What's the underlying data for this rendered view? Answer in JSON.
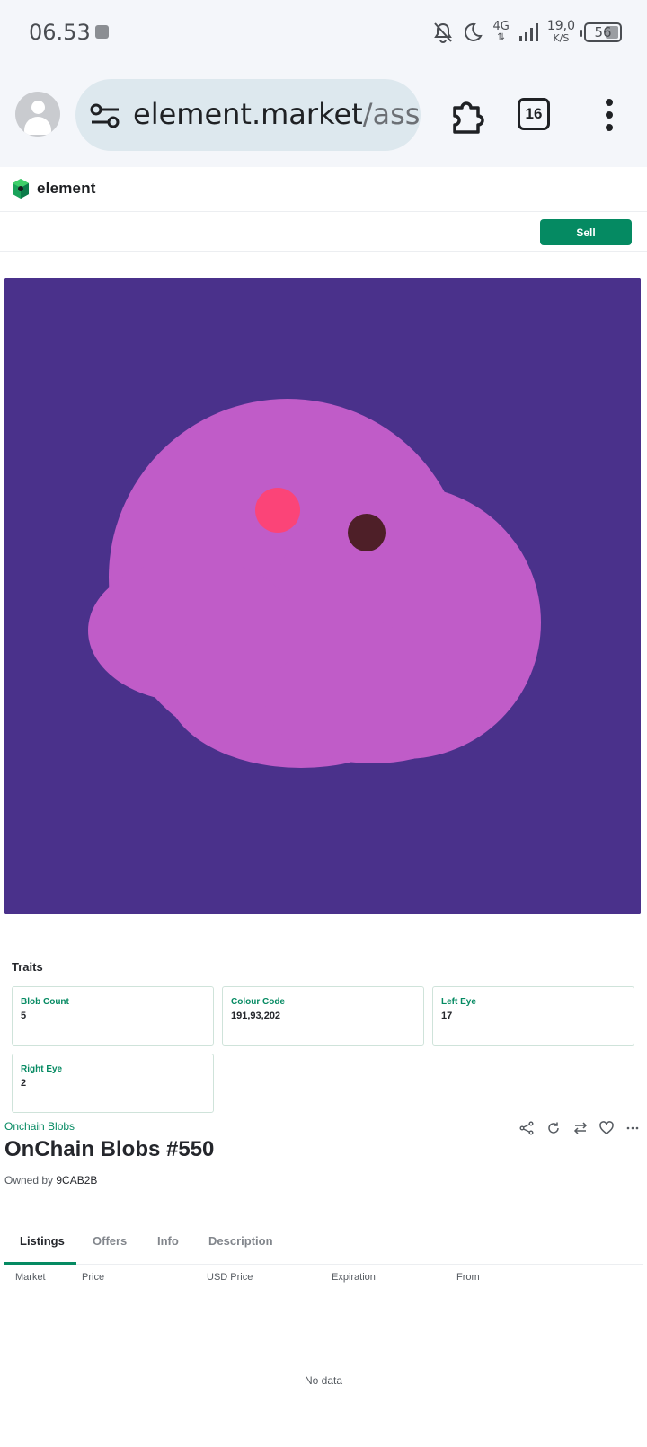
{
  "status_bar": {
    "time": "06.53",
    "network": "4G",
    "speed_value": "19,0",
    "speed_unit": "K/S",
    "battery": "56"
  },
  "browser": {
    "url_domain": "element.market",
    "url_path": "/assets",
    "tab_count": "16",
    "icons": [
      "account-icon",
      "site-settings-icon",
      "extensions-icon",
      "tab-switcher-icon",
      "more-menu-icon"
    ]
  },
  "site": {
    "logo_text": "element",
    "sell_label": "Sell",
    "brand_color": "#058a62"
  },
  "artwork": {
    "background": "#4a318b",
    "blob_color": "#c05cc8",
    "left_eye_color": "#fb4478",
    "right_eye_color": "#4e1f28"
  },
  "traits": {
    "title": "Traits",
    "items": [
      {
        "key": "Blob Count",
        "value": "5"
      },
      {
        "key": "Colour Code",
        "value": "191,93,202"
      },
      {
        "key": "Left Eye",
        "value": "17"
      },
      {
        "key": "Right Eye",
        "value": "2"
      }
    ]
  },
  "asset": {
    "collection": "Onchain Blobs",
    "title": "OnChain Blobs #550",
    "owned_prefix": "Owned by",
    "owner": "9CAB2B",
    "actions": [
      "share-icon",
      "refresh-icon",
      "transfer-icon",
      "favorite-icon",
      "more-icon"
    ]
  },
  "tabs": [
    "Listings",
    "Offers",
    "Info",
    "Description"
  ],
  "listings": {
    "columns": [
      "Market",
      "Price",
      "USD Price",
      "Expiration",
      "From"
    ],
    "empty_text": "No data"
  }
}
